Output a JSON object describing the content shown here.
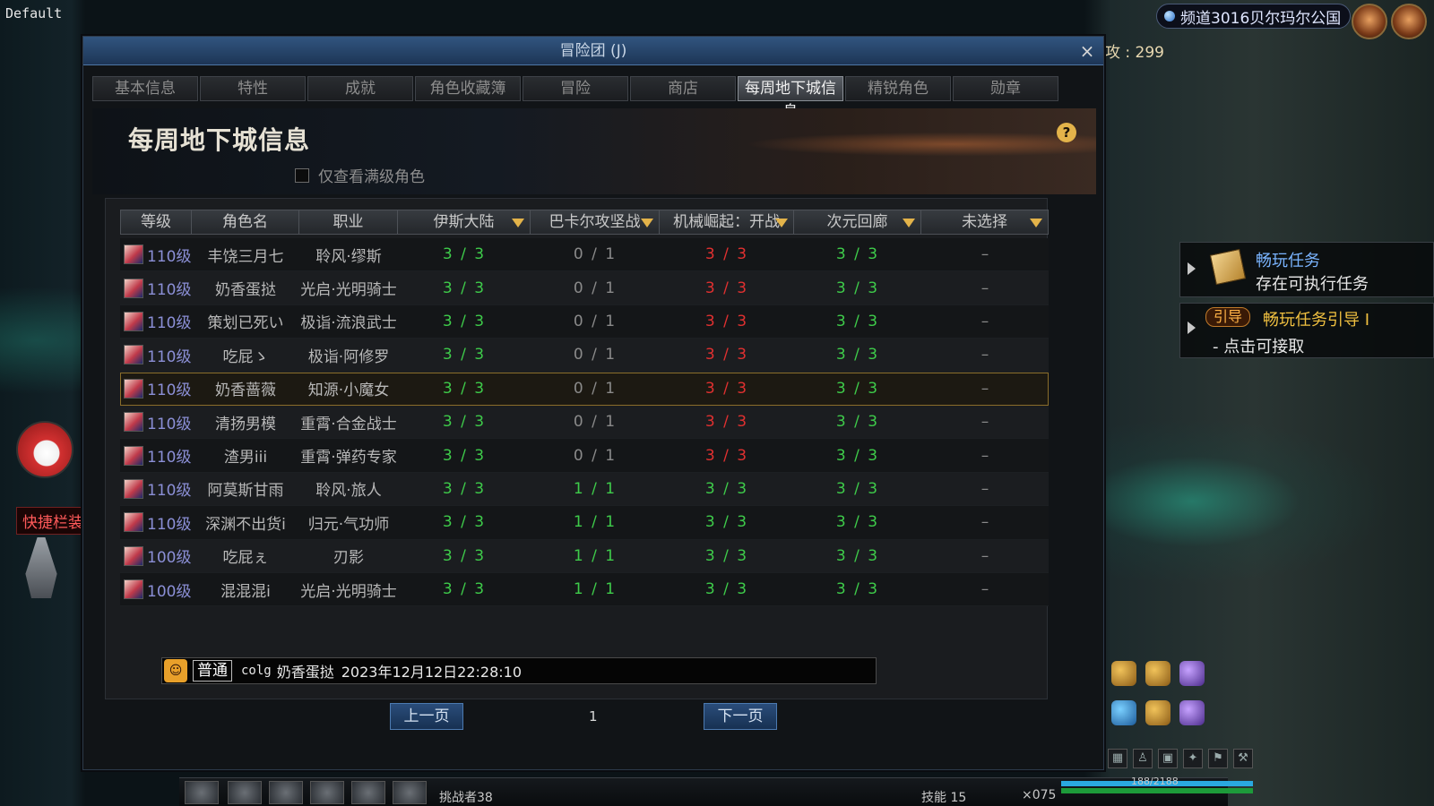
{
  "app": {
    "corner_label": "Default",
    "channel": "频道3016贝尔玛尔公国",
    "score_label": "攻 : 299"
  },
  "window": {
    "title": "冒险团 (J)",
    "close_symbol": "×"
  },
  "tabs": [
    {
      "label": "基本信息",
      "active": false
    },
    {
      "label": "特性",
      "active": false
    },
    {
      "label": "成就",
      "active": false
    },
    {
      "label": "角色收藏簿",
      "active": false
    },
    {
      "label": "冒险",
      "active": false
    },
    {
      "label": "商店",
      "active": false
    },
    {
      "label": "每周地下城信息",
      "active": true
    },
    {
      "label": "精锐角色",
      "active": false
    },
    {
      "label": "勋章",
      "active": false
    }
  ],
  "page": {
    "title": "每周地下城信息",
    "help_symbol": "?",
    "filter_label": "仅查看满级角色",
    "filter_checked": false
  },
  "columns": [
    "等级",
    "角色名",
    "职业",
    "伊斯大陆",
    "巴卡尔攻坚战",
    "机械崛起：开战",
    "次元回廊",
    "未选择"
  ],
  "dropdown_columns": [
    3,
    4,
    5,
    6,
    7
  ],
  "rows": [
    {
      "level": "110级",
      "name": "丰饶三月七",
      "job": "聆风·缪斯",
      "a": "3 / 3",
      "b": "0 / 1",
      "c": "3 / 3",
      "d": "3 / 3",
      "e": "–",
      "b_full": false,
      "c_ok": false,
      "highlight": false
    },
    {
      "level": "110级",
      "name": "奶香蛋挞",
      "job": "光启·光明骑士",
      "a": "3 / 3",
      "b": "0 / 1",
      "c": "3 / 3",
      "d": "3 / 3",
      "e": "–",
      "b_full": false,
      "c_ok": false,
      "highlight": false
    },
    {
      "level": "110级",
      "name": "策划已死い",
      "job": "极诣·流浪武士",
      "a": "3 / 3",
      "b": "0 / 1",
      "c": "3 / 3",
      "d": "3 / 3",
      "e": "–",
      "b_full": false,
      "c_ok": false,
      "highlight": false
    },
    {
      "level": "110级",
      "name": "吃屁ゝ",
      "job": "极诣·阿修罗",
      "a": "3 / 3",
      "b": "0 / 1",
      "c": "3 / 3",
      "d": "3 / 3",
      "e": "–",
      "b_full": false,
      "c_ok": false,
      "highlight": false
    },
    {
      "level": "110级",
      "name": "奶香蔷薇",
      "job": "知源·小魔女",
      "a": "3 / 3",
      "b": "0 / 1",
      "c": "3 / 3",
      "d": "3 / 3",
      "e": "–",
      "b_full": false,
      "c_ok": false,
      "highlight": true
    },
    {
      "level": "110级",
      "name": "清扬男模",
      "job": "重霄·合金战士",
      "a": "3 / 3",
      "b": "0 / 1",
      "c": "3 / 3",
      "d": "3 / 3",
      "e": "–",
      "b_full": false,
      "c_ok": false,
      "highlight": false
    },
    {
      "level": "110级",
      "name": "渣男iii",
      "job": "重霄·弹药专家",
      "a": "3 / 3",
      "b": "0 / 1",
      "c": "3 / 3",
      "d": "3 / 3",
      "e": "–",
      "b_full": false,
      "c_ok": false,
      "highlight": false
    },
    {
      "level": "110级",
      "name": "阿莫斯甘雨",
      "job": "聆风·旅人",
      "a": "3 / 3",
      "b": "1 / 1",
      "c": "3 / 3",
      "d": "3 / 3",
      "e": "–",
      "b_full": true,
      "c_ok": true,
      "highlight": false
    },
    {
      "level": "110级",
      "name": "深渊不出货i",
      "job": "归元·气功师",
      "a": "3 / 3",
      "b": "1 / 1",
      "c": "3 / 3",
      "d": "3 / 3",
      "e": "–",
      "b_full": true,
      "c_ok": true,
      "highlight": false
    },
    {
      "level": "100级",
      "name": "吃屁ぇ",
      "job": "刃影",
      "a": "3 / 3",
      "b": "1 / 1",
      "c": "3 / 3",
      "d": "3 / 3",
      "e": "–",
      "b_full": true,
      "c_ok": true,
      "highlight": false
    },
    {
      "level": "100级",
      "name": "混混混i",
      "job": "光启·光明骑士",
      "a": "3 / 3",
      "b": "1 / 1",
      "c": "3 / 3",
      "d": "3 / 3",
      "e": "–",
      "b_full": true,
      "c_ok": true,
      "highlight": false
    }
  ],
  "message": {
    "type_label": "普通",
    "source": "colg",
    "sender": "奶香蛋挞",
    "time": "2023年12月12日22:28:10"
  },
  "pagination": {
    "prev": "上一页",
    "page": "1",
    "next": "下一页"
  },
  "quests": {
    "q1_title": "畅玩任务",
    "q1_sub": "存在可执行任务",
    "q2_badge": "引导",
    "q2_title": "畅玩任务引导 I",
    "q2_sub": "- 点击可接取"
  },
  "left": {
    "shortcut_tag": "快捷栏装"
  },
  "hud": {
    "challenger": "挑战者38",
    "skill": "技能 15",
    "hp": "188/2188",
    "coin": "×075"
  },
  "colors": {
    "green": "#3ecb4a",
    "red": "#e03030",
    "gold": "#e3b34a",
    "level_blue": "#8b8fd6"
  }
}
